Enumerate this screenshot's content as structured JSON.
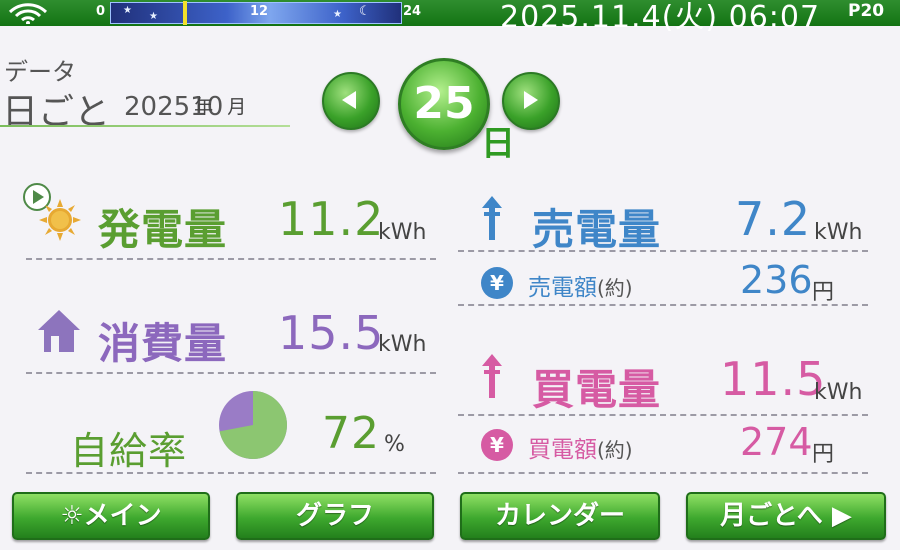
{
  "status_bar": {
    "timeline_ticks": [
      "0",
      "12",
      "24"
    ],
    "datetime": "2025.11.4(火) 06:07",
    "page": "P20"
  },
  "header": {
    "section": "データ",
    "mode": "日ごと",
    "year": "2025",
    "year_unit": "年",
    "month": "10",
    "month_unit": "月",
    "day": "25",
    "day_unit": "日"
  },
  "generation": {
    "label": "発電量",
    "value": "11.2",
    "unit": "kWh",
    "color": "#5a9e31"
  },
  "consumption": {
    "label": "消費量",
    "value": "15.5",
    "unit": "kWh",
    "color": "#8c68bd"
  },
  "self_sufficiency": {
    "label": "自給率",
    "value": "72",
    "unit": "%",
    "ratio": 0.72
  },
  "sold": {
    "label": "売電量",
    "value": "7.2",
    "unit": "kWh",
    "color": "#3f86c8",
    "amount_label": "売電額",
    "amount_note": "(約)",
    "amount": "236",
    "amount_unit": "円"
  },
  "bought": {
    "label": "買電量",
    "value": "11.5",
    "unit": "kWh",
    "color": "#d65ba3",
    "amount_label": "買電額",
    "amount_note": "(約)",
    "amount": "274",
    "amount_unit": "円"
  },
  "buttons": {
    "main": "メイン",
    "graph": "グラフ",
    "calendar": "カレンダー",
    "monthly": "月ごとへ"
  },
  "icons": {
    "wifi": "wifi-icon",
    "sun": "sun-icon",
    "house": "house-icon",
    "pie": "pie-chart-icon",
    "sell_arrow": "arrow-up-icon",
    "buy_arrow": "arrow-down-icon",
    "yen": "yen-icon",
    "prev": "triangle-left-icon",
    "next": "triangle-right-icon"
  }
}
